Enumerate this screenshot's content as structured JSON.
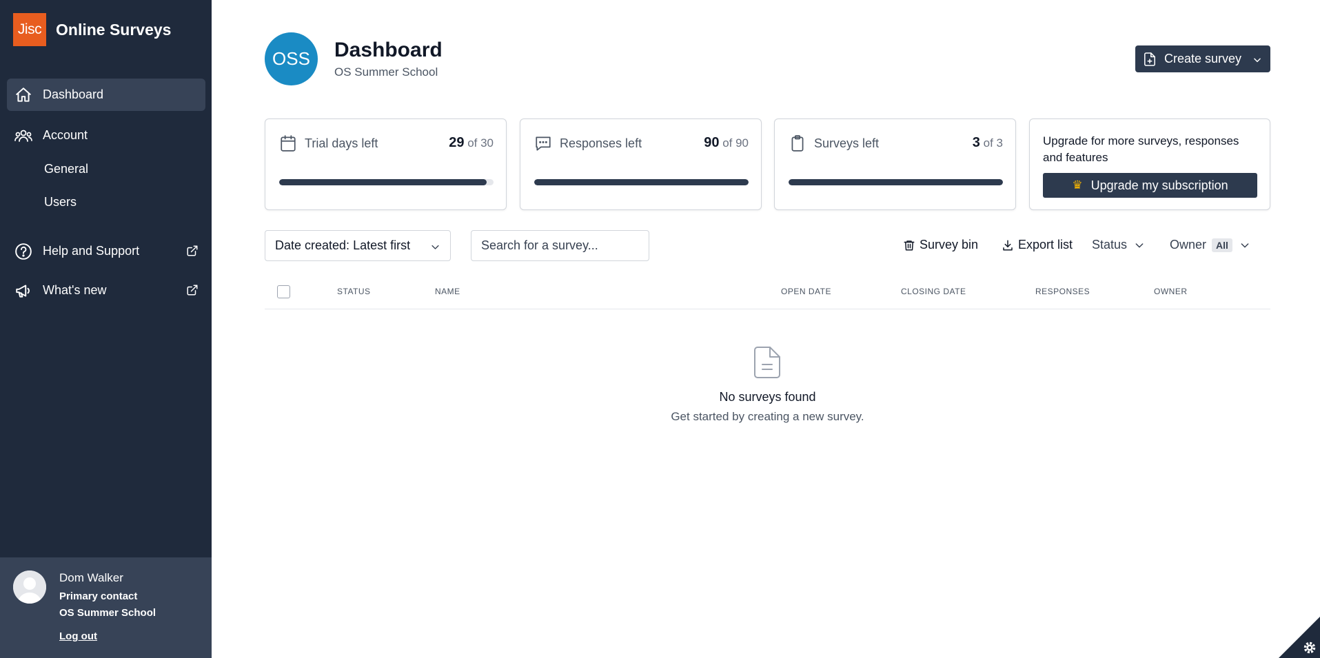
{
  "app": {
    "logo_text": "Jisc",
    "title": "Online Surveys"
  },
  "sidebar": {
    "dashboard": "Dashboard",
    "account": "Account",
    "general": "General",
    "users": "Users",
    "help": "Help and Support",
    "whats_new": "What's new"
  },
  "user": {
    "name": "Dom Walker",
    "role": "Primary contact",
    "org": "OS Summer School",
    "logout": "Log out"
  },
  "header": {
    "org_initials": "OSS",
    "title": "Dashboard",
    "subtitle": "OS Summer School",
    "create_label": "Create survey"
  },
  "stats": [
    {
      "label": "Trial days left",
      "value": "29",
      "total": "of 30",
      "fraction": 0.967
    },
    {
      "label": "Responses left",
      "value": "90",
      "total": "of 90",
      "fraction": 1.0
    },
    {
      "label": "Surveys left",
      "value": "3",
      "total": "of 3",
      "fraction": 1.0
    }
  ],
  "upgrade": {
    "text": "Upgrade for more surveys, responses and features",
    "button": "Upgrade my subscription"
  },
  "toolbar": {
    "sort_value": "Date created: Latest first",
    "search_placeholder": "Search for a survey...",
    "survey_bin": "Survey bin",
    "export": "Export list",
    "status": "Status",
    "owner": "Owner",
    "owner_value": "All"
  },
  "table": {
    "headers": [
      "STATUS",
      "NAME",
      "OPEN DATE",
      "CLOSING DATE",
      "RESPONSES",
      "OWNER"
    ]
  },
  "empty": {
    "title": "No surveys found",
    "subtitle": "Get started by creating a new survey."
  },
  "colors": {
    "sidebar_bg": "#1f2a3c",
    "accent": "#e85d1f",
    "primary_button": "#2d3a4e",
    "org_avatar": "#1a8bc4"
  }
}
